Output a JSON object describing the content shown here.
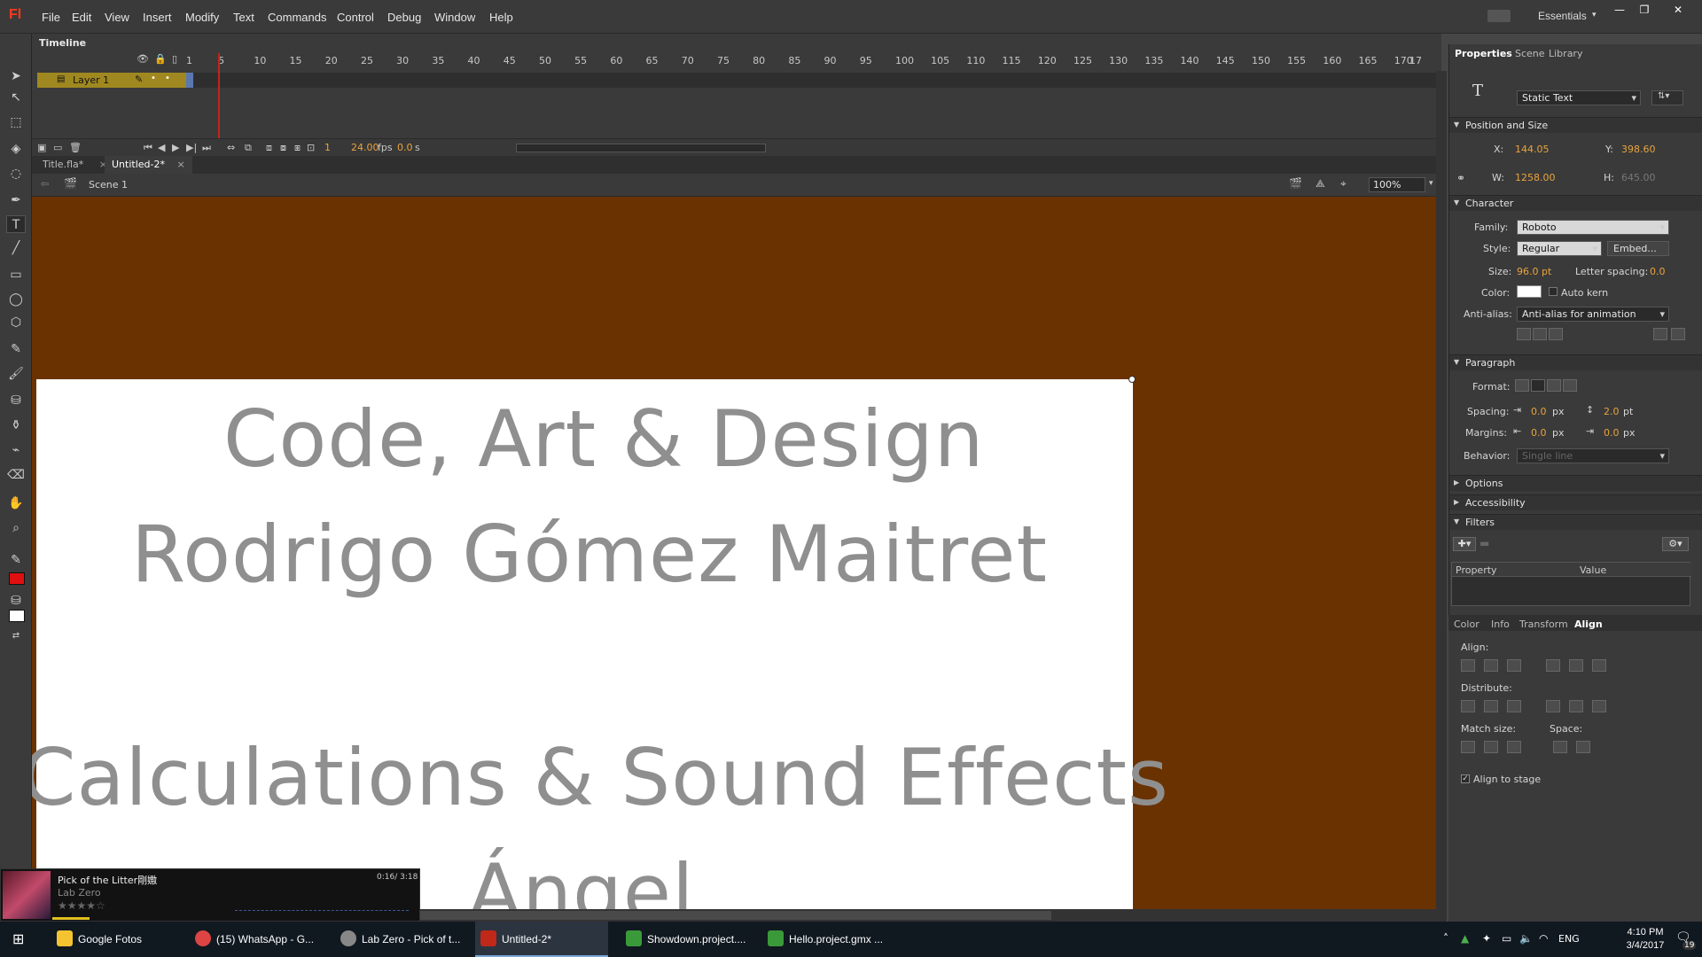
{
  "app": {
    "logo": "Fl",
    "menu": [
      "File",
      "Edit",
      "View",
      "Insert",
      "Modify",
      "Text",
      "Commands",
      "Control",
      "Debug",
      "Window",
      "Help"
    ],
    "workspace": "Essentials"
  },
  "timeline": {
    "tab": "Timeline",
    "ruler": [
      "1",
      "5",
      "10",
      "15",
      "20",
      "25",
      "30",
      "35",
      "40",
      "45",
      "50",
      "55",
      "60",
      "65",
      "70",
      "75",
      "80",
      "85",
      "90",
      "95",
      "100",
      "105",
      "110",
      "115",
      "120",
      "125",
      "130",
      "135",
      "140",
      "145",
      "150",
      "155",
      "160",
      "165",
      "170",
      "17"
    ],
    "layer_name": "Layer 1",
    "current_frame": "1",
    "fps": "24.00",
    "fps_unit": "fps",
    "elapsed": "0.0",
    "elapsed_unit": "s"
  },
  "doc_tabs": [
    {
      "label": "Title.fla*",
      "active": false
    },
    {
      "label": "Untitled-2*",
      "active": true
    }
  ],
  "editbar": {
    "scene": "Scene 1",
    "zoom": "100%"
  },
  "stage": {
    "background_color": "#6a3200",
    "lines": [
      "Code, Art & Design",
      "Rodrigo Gómez Maitret",
      "Calculations & Sound Effects",
      "Ángel"
    ]
  },
  "properties": {
    "tabs": [
      "Properties",
      "Scene",
      "Library"
    ],
    "text_type": "Static Text",
    "position_size": {
      "title": "Position and Size",
      "x_label": "X:",
      "x": "144.05",
      "y_label": "Y:",
      "y": "398.60",
      "w_label": "W:",
      "w": "1258.00",
      "h_label": "H:",
      "h": "645.00"
    },
    "character": {
      "title": "Character",
      "family_label": "Family:",
      "family": "Roboto",
      "style_label": "Style:",
      "style": "Regular",
      "embed": "Embed...",
      "size_label": "Size:",
      "size": "96.0 pt",
      "letter_spacing_label": "Letter spacing:",
      "letter_spacing": "0.0",
      "color_label": "Color:",
      "color": "#ffffff",
      "auto_kern": "Auto kern",
      "antialias_label": "Anti-alias:",
      "antialias": "Anti-alias for animation"
    },
    "paragraph": {
      "title": "Paragraph",
      "format_label": "Format:",
      "spacing_label": "Spacing:",
      "spacing_indent": "0.0",
      "spacing_indent_unit": "px",
      "line_spacing": "2.0",
      "line_spacing_unit": "pt",
      "margins_label": "Margins:",
      "margin_left": "0.0",
      "margin_left_unit": "px",
      "margin_right": "0.0",
      "margin_right_unit": "px",
      "behavior_label": "Behavior:",
      "behavior": "Single line"
    },
    "options": "Options",
    "accessibility": "Accessibility",
    "filters": {
      "title": "Filters",
      "col_property": "Property",
      "col_value": "Value"
    }
  },
  "align_panel": {
    "tabs": [
      "Color",
      "Info",
      "Transform",
      "Align"
    ],
    "align_label": "Align:",
    "distribute_label": "Distribute:",
    "match_size_label": "Match size:",
    "space_label": "Space:",
    "align_to_stage": "Align to stage"
  },
  "music": {
    "title": "Pick of the Litter剛嫐",
    "artist": "Lab Zero",
    "time": "0:16/ 3:18",
    "rating": 4,
    "rating_max": 5
  },
  "taskbar": {
    "items": [
      "Google Fotos",
      "(15) WhatsApp - G...",
      "Lab Zero - Pick of t...",
      "Untitled-2*",
      "Showdown.project....",
      "Hello.project.gmx ..."
    ],
    "lang": "ENG",
    "time": "4:10 PM",
    "date": "3/4/2017",
    "notifications": "19"
  }
}
